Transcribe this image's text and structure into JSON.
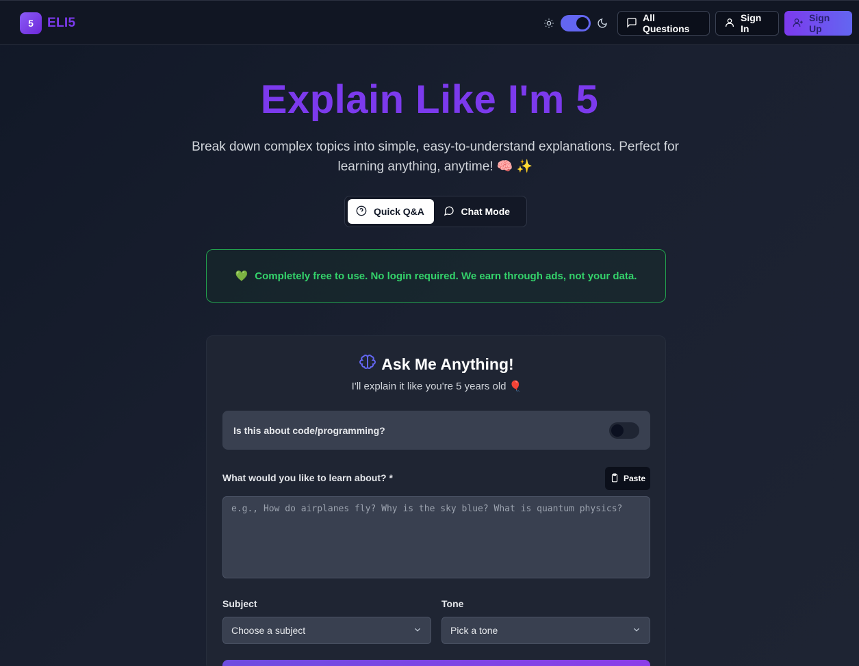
{
  "header": {
    "logo_badge": "5",
    "logo_text": "ELI5",
    "all_questions": "All Questions",
    "sign_in": "Sign In",
    "sign_up": "Sign Up",
    "theme": "dark"
  },
  "hero": {
    "title": "Explain Like I'm 5",
    "subtitle": "Break down complex topics into simple, easy-to-understand explanations. Perfect for learning anything, anytime! 🧠 ✨"
  },
  "modes": {
    "quick": "Quick Q&A",
    "chat": "Chat Mode",
    "active": "quick"
  },
  "banner": {
    "emoji": "💚",
    "text": "Completely free to use. No login required. We earn through ads, not your data."
  },
  "card": {
    "title": "Ask Me Anything!",
    "subtitle": "I'll explain it like you're 5 years old 🎈",
    "code_question": "Is this about code/programming?",
    "code_toggle": false,
    "learn_label": "What would you like to learn about? *",
    "paste": "Paste",
    "question_placeholder": "e.g., How do airplanes fly? Why is the sky blue? What is quantum physics?",
    "question_value": "",
    "subject_label": "Subject",
    "subject_value": "Choose a subject",
    "tone_label": "Tone",
    "tone_value": "Pick a tone"
  },
  "colors": {
    "accent": "#7c3aed",
    "success": "#34d36b"
  }
}
